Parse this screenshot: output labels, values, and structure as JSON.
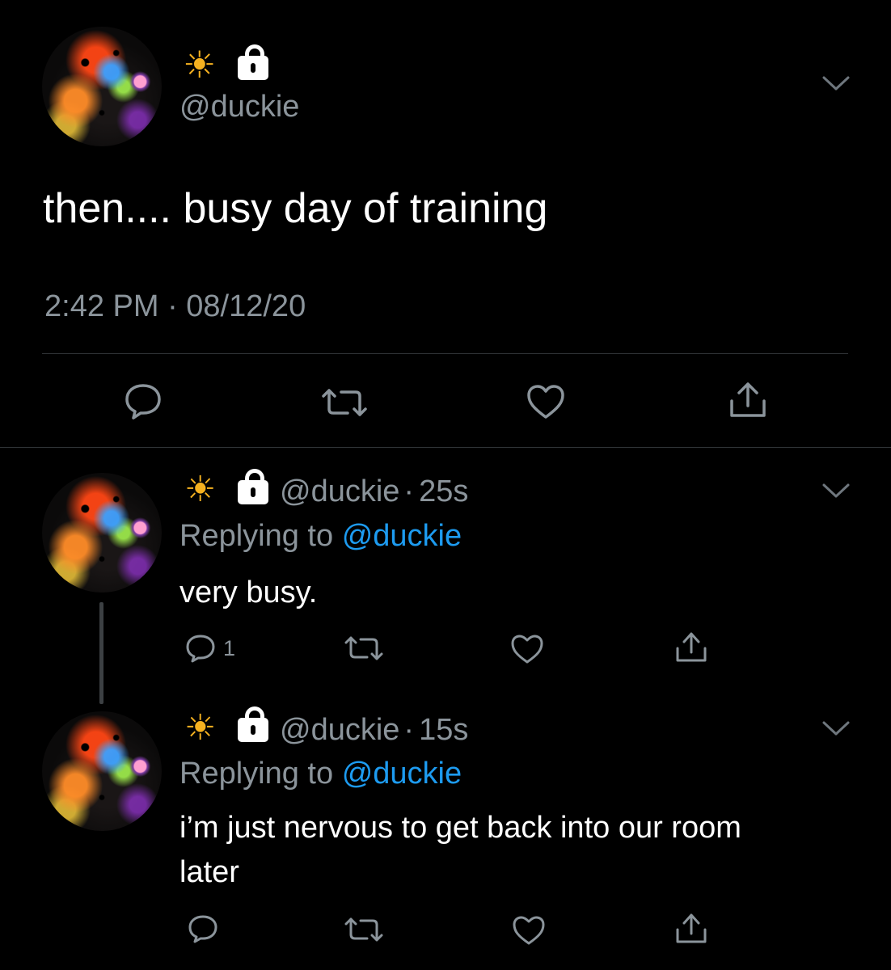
{
  "main_tweet": {
    "handle": "@duckie",
    "text": "then.... busy day of training",
    "timestamp": "2:42 PM · 08/12/20",
    "emoji": "☀"
  },
  "replies": [
    {
      "handle": "@duckie",
      "dot": "·",
      "age": "25s",
      "replying_label": "Replying to",
      "replying_to": "@duckie",
      "text": "very busy.",
      "reply_count": "1",
      "emoji": "☀"
    },
    {
      "handle": "@duckie",
      "dot": "·",
      "age": "15s",
      "replying_label": "Replying to",
      "replying_to": "@duckie",
      "text_line1": "i’m just nervous to get back into our room",
      "text_line2": "later",
      "emoji": "☀"
    }
  ],
  "icons": [
    "reply-icon",
    "retweet-icon",
    "like-icon",
    "share-icon",
    "chevron-down-icon",
    "lock-icon",
    "sun-emoji"
  ],
  "colors": {
    "background": "#000000",
    "muted": "#8b949b",
    "link": "#1d9bf0",
    "divider": "#2f3336",
    "sun": "#f5b120"
  }
}
